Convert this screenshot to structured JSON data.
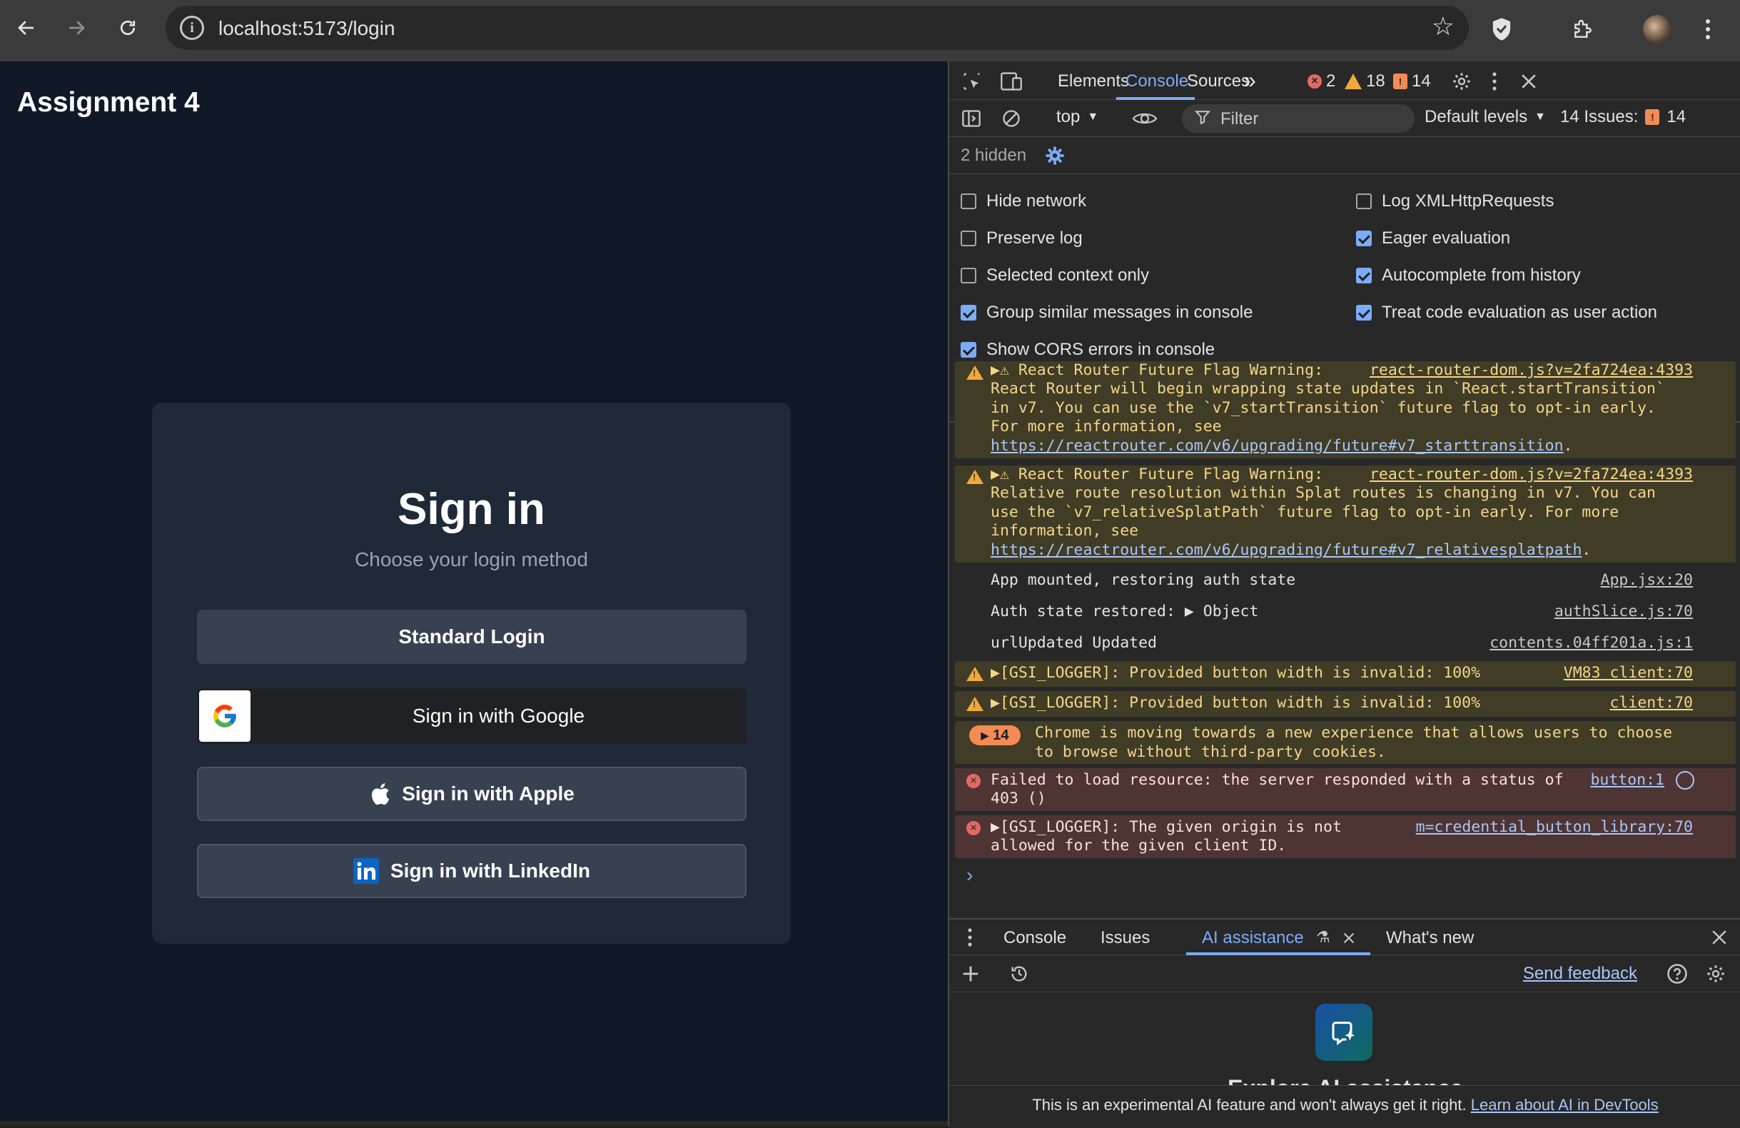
{
  "browser": {
    "url": "localhost:5173/login"
  },
  "page": {
    "app_title": "Assignment 4",
    "signin": {
      "title": "Sign in",
      "subtitle": "Choose your login method",
      "standard_label": "Standard Login",
      "google_label": "Sign in with Google",
      "apple_label": "Sign in with Apple",
      "linkedin_label": "Sign in with LinkedIn"
    }
  },
  "devtools": {
    "tabs": [
      "Elements",
      "Console",
      "Sources"
    ],
    "more_tabs": "»",
    "error_count": "2",
    "warning_count": "18",
    "issue_count": "14",
    "context": "top",
    "filter_placeholder": "Filter",
    "levels": "Default levels",
    "issues_label": "14 Issues:",
    "issues_count": "14",
    "hidden": "2 hidden",
    "settings": {
      "left": [
        {
          "label": "Hide network",
          "checked": false
        },
        {
          "label": "Preserve log",
          "checked": false
        },
        {
          "label": "Selected context only",
          "checked": false
        },
        {
          "label": "Group similar messages in console",
          "checked": true
        },
        {
          "label": "Show CORS errors in console",
          "checked": true
        }
      ],
      "right": [
        {
          "label": "Log XMLHttpRequests",
          "checked": false
        },
        {
          "label": "Eager evaluation",
          "checked": true
        },
        {
          "label": "Autocomplete from history",
          "checked": true
        },
        {
          "label": "Treat code evaluation as user action",
          "checked": true
        }
      ]
    },
    "messages": {
      "m1": {
        "head": "React Router Future Flag Warning:",
        "src": "react-router-dom.js?v=2fa724ea:4393",
        "body": "React Router will begin wrapping state updates in `React.startTransition`\nin v7. You can use the `v7_startTransition` future flag to opt-in early.\nFor more information, see",
        "link": "https://reactrouter.com/v6/upgrading/future#v7_starttransition",
        "tail": "."
      },
      "m2": {
        "head": "React Router Future Flag Warning:",
        "src": "react-router-dom.js?v=2fa724ea:4393",
        "body": "Relative route resolution within Splat routes is changing in v7. You can\nuse the `v7_relativeSplatPath` future flag to opt-in early. For more\ninformation, see",
        "link": "https://reactrouter.com/v6/upgrading/future#v7_relativesplatpath",
        "tail": "."
      },
      "m3": {
        "text": "App mounted, restoring auth state",
        "src": "App.jsx:20"
      },
      "m4": {
        "text": "Auth state restored:",
        "obj": "Object",
        "src": "authSlice.js:70"
      },
      "m5": {
        "text": "urlUpdated Updated",
        "src": "contents.04ff201a.js:1"
      },
      "m6": {
        "text": "[GSI_LOGGER]: Provided button width is invalid: 100%",
        "src": "VM83 client:70"
      },
      "m7": {
        "text": "[GSI_LOGGER]: Provided button width is invalid: 100%",
        "src": "client:70"
      },
      "m8": {
        "count": "14",
        "text": "Chrome is moving towards a new experience that allows users to choose\nto browse without third-party cookies."
      },
      "m9": {
        "text": "Failed to load resource: the server responded with a status of",
        "src": "button:1",
        "text2": "403 ()"
      },
      "m10": {
        "text": "[GSI_LOGGER]: The given origin is not",
        "src": "m=credential_button_library:70",
        "text2": "allowed for the given client ID."
      }
    },
    "prompt": "›",
    "drawer": {
      "tabs": [
        "Console",
        "Issues",
        "AI assistance",
        "What's new"
      ],
      "send_feedback": "Send feedback",
      "ai_heading": "Explore AI assistance",
      "footer_text": "This is an experimental AI feature and won't always get it right.",
      "footer_link": "Learn about AI in DevTools"
    }
  },
  "colors": {
    "page_bg": "#111827",
    "card_bg": "#1f2937",
    "button_bg": "#374151",
    "devtools_accent": "#7cacf8",
    "warning_bg": "#413c26",
    "error_bg": "#4e3534",
    "linkedin": "#0a66c2"
  }
}
